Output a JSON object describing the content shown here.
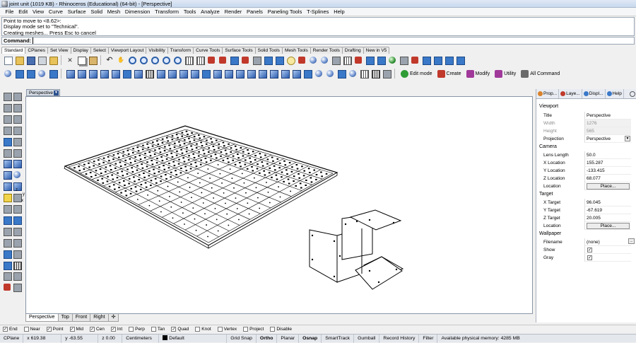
{
  "window": {
    "title": "joint unit (1019 KB) - Rhinoceros (Educational) (64-bit) - [Perspective]"
  },
  "menu": [
    "File",
    "Edit",
    "View",
    "Curve",
    "Surface",
    "Solid",
    "Mesh",
    "Dimension",
    "Transform",
    "Tools",
    "Analyze",
    "Render",
    "Panels",
    "Paneling Tools",
    "T-Splines",
    "Help"
  ],
  "command": {
    "history": [
      "Point to move to <8.62>:",
      "Display mode set to \"Technical\".",
      "Creating meshes... Press Esc to cancel"
    ],
    "label": "Command:",
    "value": ""
  },
  "toolbar_tabs": [
    "Standard",
    "CPlanes",
    "Set View",
    "Display",
    "Select",
    "Viewport Layout",
    "Visibility",
    "Transform",
    "Curve Tools",
    "Surface Tools",
    "Solid Tools",
    "Mesh Tools",
    "Render Tools",
    "Drafting",
    "New in V5"
  ],
  "toolbar_text_buttons": [
    {
      "label": "Edit mode",
      "color": "#2f9b35"
    },
    {
      "label": "Create",
      "color": "#c0392b"
    },
    {
      "label": "Modify",
      "color": "#a0399a"
    },
    {
      "label": "Utility",
      "color": "#a0399a"
    },
    {
      "label": "All Command",
      "color": "#6a6a6a"
    }
  ],
  "viewport": {
    "active_label": "Perspective",
    "tabs": [
      "Perspective",
      "Top",
      "Front",
      "Right"
    ],
    "add_tab": "✣",
    "axes": {
      "x": "x",
      "y": "y",
      "z": "z"
    }
  },
  "panel": {
    "tabs": [
      {
        "label": "Prop...",
        "color": "#d9822b"
      },
      {
        "label": "Laye...",
        "color": "#c0392b"
      },
      {
        "label": "Displ...",
        "color": "#3a78c8"
      },
      {
        "label": "Help",
        "color": "#3a78c8"
      }
    ],
    "viewport_section": "Viewport",
    "title_key": "Title",
    "title_val": "Perspective",
    "width_key": "Width",
    "width_val": "1276",
    "height_key": "Height",
    "height_val": "565",
    "projection_key": "Projection",
    "projection_val": "Perspective",
    "camera_section": "Camera",
    "lens_key": "Lens Length",
    "lens_val": "50.0",
    "cx_key": "X Location",
    "cx_val": "155.287",
    "cy_key": "Y Location",
    "cy_val": "-133.415",
    "cz_key": "Z Location",
    "cz_val": "68.077",
    "cloc_key": "Location",
    "place_label": "Place...",
    "target_section": "Target",
    "tx_key": "X Target",
    "tx_val": "96.045",
    "ty_key": "Y Target",
    "ty_val": "-67.619",
    "tz_key": "Z Target",
    "tz_val": "20.005",
    "tloc_key": "Location",
    "wall_section": "Wallpaper",
    "fname_key": "Filename",
    "fname_val": "(none)",
    "fname_btn": "...",
    "show_key": "Show",
    "show_checked": true,
    "gray_key": "Gray",
    "gray_checked": true,
    "check_mark": "✓"
  },
  "osnaps": [
    {
      "label": "End",
      "checked": true
    },
    {
      "label": "Near",
      "checked": false
    },
    {
      "label": "Point",
      "checked": true
    },
    {
      "label": "Mid",
      "checked": true
    },
    {
      "label": "Cen",
      "checked": true
    },
    {
      "label": "Int",
      "checked": true
    },
    {
      "label": "Perp",
      "checked": false
    },
    {
      "label": "Tan",
      "checked": false
    },
    {
      "label": "Quad",
      "checked": true
    },
    {
      "label": "Knot",
      "checked": false
    },
    {
      "label": "Vertex",
      "checked": false
    },
    {
      "label": "Project",
      "checked": false
    },
    {
      "label": "Disable",
      "checked": false
    }
  ],
  "status": {
    "cplane": "CPlane",
    "x": "x 619.38",
    "y": "y -63.55",
    "z": "z 0.00",
    "units": "Centimeters",
    "layer": "Default",
    "grid_snap": "Grid Snap",
    "ortho": "Ortho",
    "planar": "Planar",
    "osnap": "Osnap",
    "smarttrack": "SmartTrack",
    "gumball": "Gumball",
    "record_history": "Record History",
    "filter": "Filter",
    "memory": "Available physical memory: 4285 MB"
  }
}
